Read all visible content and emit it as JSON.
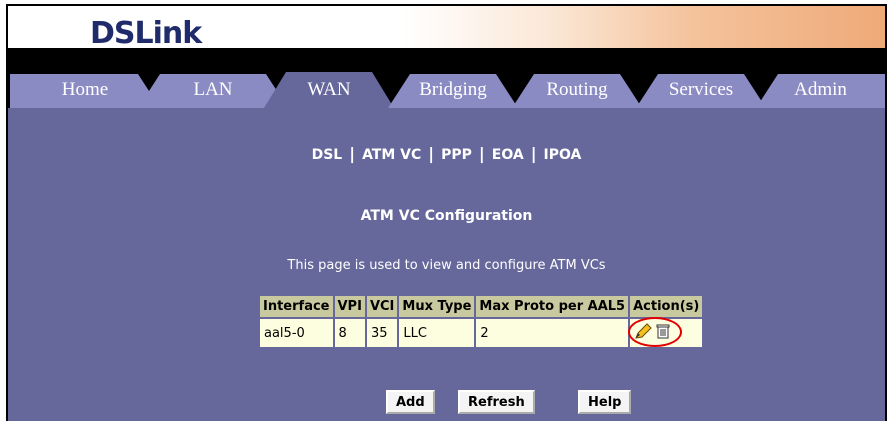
{
  "logo": {
    "text": "DSLink"
  },
  "tabs": [
    {
      "label": "Home"
    },
    {
      "label": "LAN"
    },
    {
      "label": "WAN"
    },
    {
      "label": "Bridging"
    },
    {
      "label": "Routing"
    },
    {
      "label": "Services"
    },
    {
      "label": "Admin"
    }
  ],
  "active_tab": "WAN",
  "subnav": {
    "dsl": "DSL",
    "atmvc": "ATM VC",
    "ppp": "PPP",
    "eoa": "EOA",
    "ipoa": "IPOA",
    "separator": "|"
  },
  "page": {
    "title": "ATM VC Configuration",
    "description": "This page is used to view and configure ATM VCs"
  },
  "table": {
    "headers": [
      "Interface",
      "VPI",
      "VCI",
      "Mux Type",
      "Max Proto per AAL5",
      "Action(s)"
    ],
    "rows": [
      {
        "interface": "aal5-0",
        "vpi": "8",
        "vci": "35",
        "mux": "LLC",
        "max_proto": "2"
      }
    ]
  },
  "buttons": {
    "add": "Add",
    "refresh": "Refresh",
    "help": "Help"
  },
  "colors": {
    "content_bg": "#66689c",
    "tab_bg": "#8b8bc4",
    "tab_active": "#66689c",
    "header_cell": "#c9c9a0",
    "data_cell": "#fdfde0",
    "highlight": "#e00000"
  }
}
